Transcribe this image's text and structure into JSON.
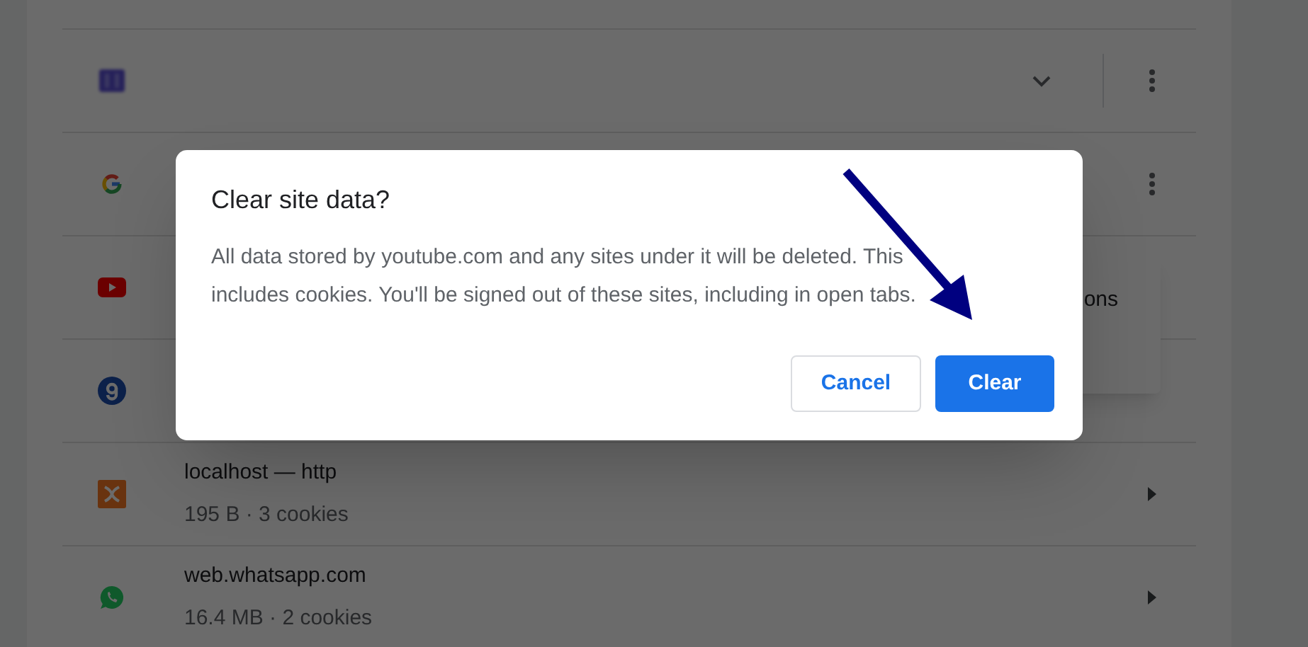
{
  "sites": [
    {
      "kind": "expandable"
    },
    {
      "kind": "menu"
    },
    {
      "kind": "covered"
    },
    {
      "kind": "covered"
    },
    {
      "kind": "link",
      "name": "localhost — http",
      "detail": "195 B · 3 cookies"
    },
    {
      "kind": "link",
      "name": "web.whatsapp.com",
      "detail": "16.4 MB · 2 cookies"
    }
  ],
  "menu": {
    "item": "ons"
  },
  "dialog": {
    "title": "Clear site data?",
    "body": "All data stored by youtube.com and any sites under it will be deleted. This includes cookies. You'll be signed out of these sites, including in open tabs.",
    "buttons": [
      {
        "label": "Cancel",
        "kind": "secondary"
      },
      {
        "label": "Clear",
        "kind": "primary"
      }
    ]
  },
  "annotation": {
    "kind": "arrow"
  }
}
